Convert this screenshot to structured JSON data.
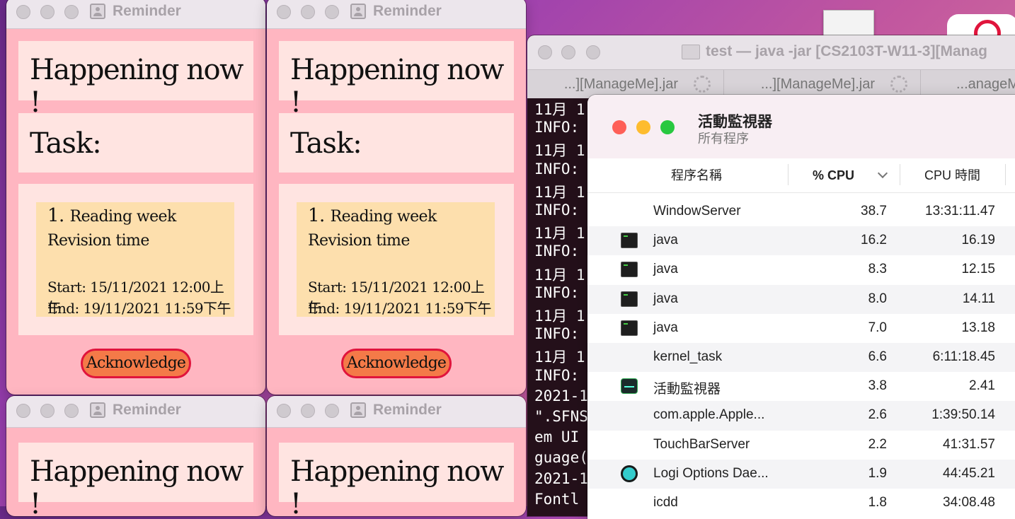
{
  "reminder": {
    "window_title": "Reminder",
    "happening": "Happening now !",
    "task_label": "Task:",
    "task_number": "1.",
    "task_line1": "Reading week",
    "task_line2": "Revision time",
    "start": "Start: 15/11/2021 12:00上午",
    "end": "End: 19/11/2021 11:59下午",
    "ack": "Acknowledge"
  },
  "terminal": {
    "title": "test — java -jar [CS2103T-W11-3][Manag",
    "tabs": [
      "...][ManageMe].jar",
      "...][ManageMe].jar",
      "...anageMe"
    ],
    "lines": [
      "11月 1",
      "INFO:",
      "11月 1",
      "INFO:",
      "11月 1",
      "INFO:",
      "11月 1",
      "INFO:",
      "11月 1",
      "INFO:",
      "11月 1",
      "INFO:",
      "11月 1",
      "INFO:",
      "2021-1",
      "\".SFNS",
      "em UI",
      "guage(",
      "2021-1",
      "Fontl"
    ]
  },
  "activity_monitor": {
    "title": "活動監視器",
    "subtitle": "所有程序",
    "col_name": "程序名稱",
    "col_cpu": "% CPU",
    "col_time": "CPU 時間",
    "processes": [
      {
        "name": "WindowServer",
        "cpu": "38.7",
        "time": "13:31:11.47",
        "icon": ""
      },
      {
        "name": "java",
        "cpu": "16.2",
        "time": "16.19",
        "icon": "terminal-icon"
      },
      {
        "name": "java",
        "cpu": "8.3",
        "time": "12.15",
        "icon": "terminal-icon"
      },
      {
        "name": "java",
        "cpu": "8.0",
        "time": "14.11",
        "icon": "terminal-icon"
      },
      {
        "name": "java",
        "cpu": "7.0",
        "time": "13.18",
        "icon": "terminal-icon"
      },
      {
        "name": "kernel_task",
        "cpu": "6.6",
        "time": "6:11:18.45",
        "icon": ""
      },
      {
        "name": "活動監視器",
        "cpu": "3.8",
        "time": "2.41",
        "icon": "activity-monitor-icon"
      },
      {
        "name": "com.apple.Apple...",
        "cpu": "2.6",
        "time": "1:39:50.14",
        "icon": ""
      },
      {
        "name": "TouchBarServer",
        "cpu": "2.2",
        "time": "41:31.57",
        "icon": ""
      },
      {
        "name": "Logi Options Dae...",
        "cpu": "1.9",
        "time": "44:45.21",
        "icon": "logi-icon"
      },
      {
        "name": "icdd",
        "cpu": "1.8",
        "time": "34:08.48",
        "icon": ""
      }
    ]
  }
}
